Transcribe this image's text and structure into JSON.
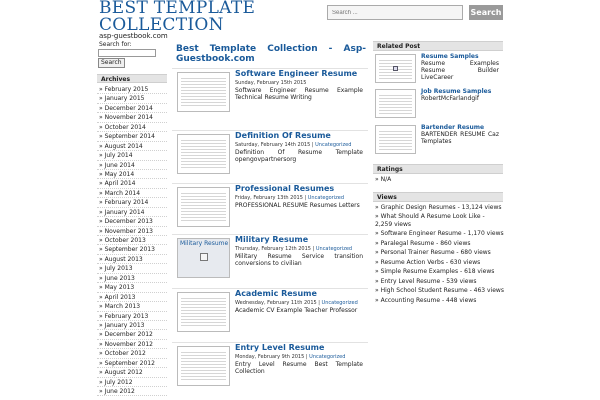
{
  "site": {
    "title": "BEST TEMPLATE COLLECTION",
    "subtitle": "asp-guestbook.com"
  },
  "top_search": {
    "placeholder": "Search ...",
    "button": "Search"
  },
  "side_search": {
    "label": "Search for:",
    "button": "Search"
  },
  "archives": {
    "heading": "Archives",
    "items": [
      "February 2015",
      "January 2015",
      "December 2014",
      "November 2014",
      "October 2014",
      "September 2014",
      "August 2014",
      "July 2014",
      "June 2014",
      "May 2014",
      "April 2014",
      "March 2014",
      "February 2014",
      "January 2014",
      "December 2013",
      "November 2013",
      "October 2013",
      "September 2013",
      "August 2013",
      "July 2013",
      "June 2013",
      "May 2013",
      "April 2013",
      "March 2013",
      "February 2013",
      "January 2013",
      "December 2012",
      "November 2012",
      "October 2012",
      "September 2012",
      "August 2012",
      "July 2012",
      "June 2012"
    ]
  },
  "main": {
    "heading_line1": "Best Template Collection - Asp-",
    "heading_line2": "Guestbook.com",
    "posts": [
      {
        "title": "Software Engineer Resume",
        "date": "Sunday, February 15th 2015",
        "category": "",
        "excerpt": "Software Engineer Resume Example Technical Resume Writing",
        "thumb_label": ""
      },
      {
        "title": "Definition Of Resume",
        "date": "Saturday, February 14th 2015 |",
        "category": "Uncategorized",
        "excerpt": "Definition Of Resume Template opengovpartnersorg",
        "thumb_label": ""
      },
      {
        "title": "Professional Resumes",
        "date": "Friday, February 13th 2015 |",
        "category": "Uncategorized",
        "excerpt": "PROFESSIONAL RESUME Resumes Letters",
        "thumb_label": ""
      },
      {
        "title": "Military Resume",
        "date": "Thursday, February 12th 2015 |",
        "category": "Uncategorized",
        "excerpt": "Military Resume Service transition conversions to civilian",
        "thumb_label": "Military Resume"
      },
      {
        "title": "Academic Resume",
        "date": "Wednesday, February 11th 2015 |",
        "category": "Uncategorized",
        "excerpt": "Academic CV Example Teacher Professor",
        "thumb_label": ""
      },
      {
        "title": "Entry Level Resume",
        "date": "Monday, February 9th 2015 |",
        "category": "Uncategorized",
        "excerpt": "Entry Level Resume Best Template Collection",
        "thumb_label": ""
      }
    ]
  },
  "related": {
    "heading": "Related Post",
    "items": [
      {
        "title": "Resume Samples",
        "desc": "Resume Examples Resume Builder LiveCareer"
      },
      {
        "title": "Job Resume Samples",
        "desc": "RobertMcFarlandgif"
      },
      {
        "title": "Bartender Resume",
        "desc": "BARTENDER RESUME Caz Templates"
      }
    ]
  },
  "ratings": {
    "heading": "Ratings",
    "value": "N/A"
  },
  "views": {
    "heading": "Views",
    "items": [
      "Graphic Design Resumes - 13,124 views",
      "What Should A Resume Look Like - 2,259 views",
      "Software Engineer Resume - 1,170 views",
      "Paralegal Resume - 860 views",
      "Personal Trainer Resume - 680 views",
      "Resume Action Verbs - 630 views",
      "Simple Resume Examples - 618 views",
      "Entry Level Resume - 539 views",
      "High School Student Resume - 463 views",
      "Accounting Resume - 448 views"
    ]
  }
}
